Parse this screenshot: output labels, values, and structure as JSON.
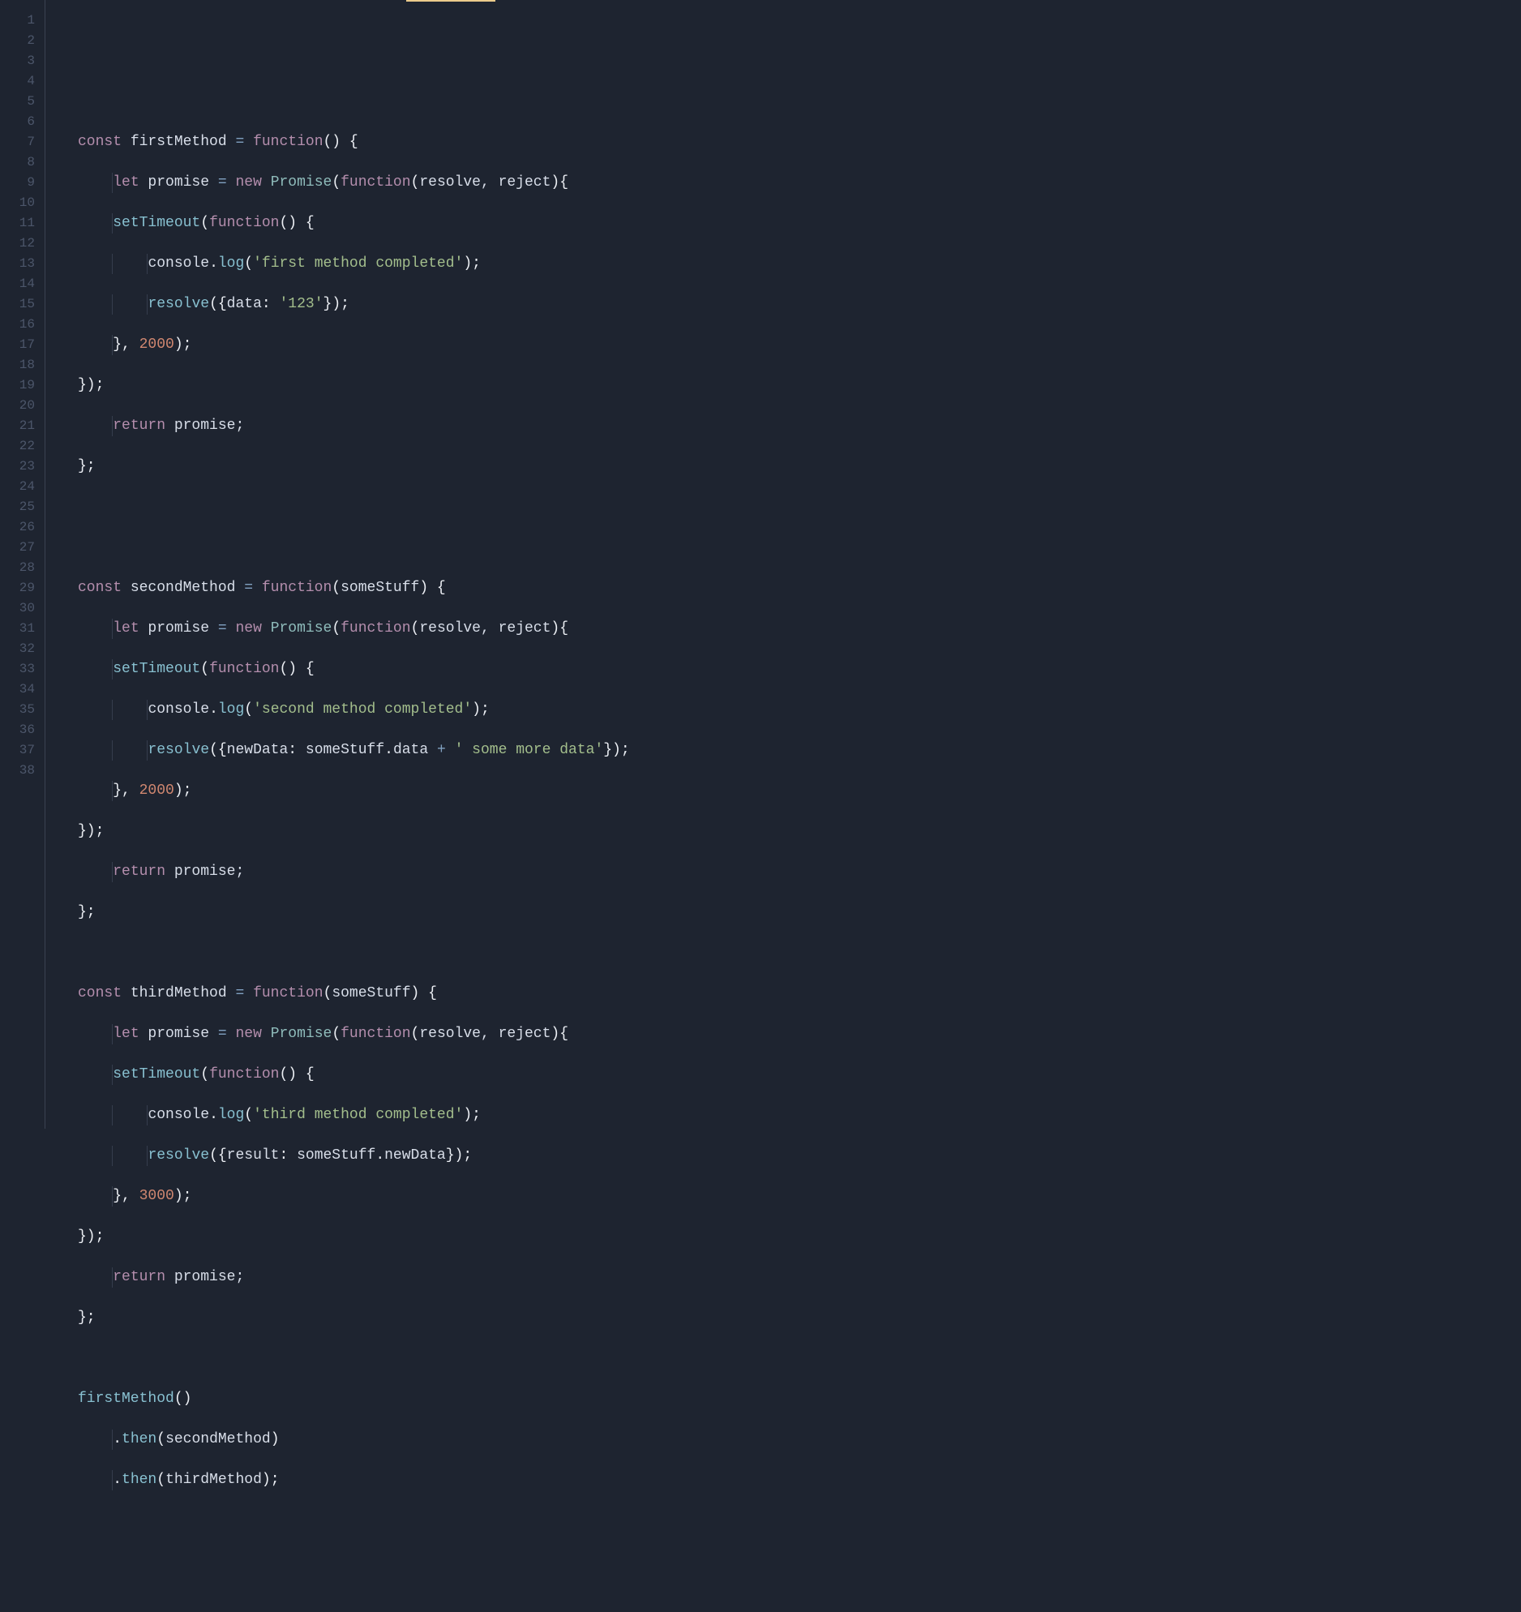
{
  "editor": {
    "lineNumbers": [
      "1",
      "2",
      "3",
      "4",
      "5",
      "6",
      "7",
      "8",
      "9",
      "10",
      "11",
      "12",
      "13",
      "14",
      "15",
      "16",
      "17",
      "18",
      "19",
      "20",
      "21",
      "22",
      "23",
      "24",
      "25",
      "26",
      "27",
      "28",
      "29",
      "30",
      "31",
      "32",
      "33",
      "34",
      "35",
      "36",
      "37",
      "38"
    ]
  },
  "code": {
    "ln1": "",
    "ln2": "",
    "ln3_const": "const",
    "ln3_name": " firstMethod ",
    "ln3_eq": "=",
    "ln3_sp": " ",
    "ln3_func": "function",
    "ln3_paren": "() {",
    "ln4_let": "let",
    "ln4_id1": " promise ",
    "ln4_eq": "=",
    "ln4_sp1": " ",
    "ln4_new": "new",
    "ln4_sp2": " ",
    "ln4_prom": "Promise",
    "ln4_p1": "(",
    "ln4_func": "function",
    "ln4_p2": "(",
    "ln4_args": "resolve, reject",
    "ln4_p3": "){",
    "ln5_st": "setTimeout",
    "ln5_p1": "(",
    "ln5_func": "function",
    "ln5_p2": "() {",
    "ln6_cons": "console",
    "ln6_dot": ".",
    "ln6_log": "log",
    "ln6_p1": "(",
    "ln6_str": "'first method completed'",
    "ln6_p2": ");",
    "ln7_res": "resolve",
    "ln7_p1": "({",
    "ln7_key": "data",
    "ln7_col": ": ",
    "ln7_val": "'123'",
    "ln7_p2": "});",
    "ln8_p1": "}, ",
    "ln8_num": "2000",
    "ln8_p2": ");",
    "ln9": "});",
    "ln10_ret": "return",
    "ln10_id": " promise;",
    "ln11": "};",
    "ln12": "",
    "ln13": "",
    "ln14_const": "const",
    "ln14_name": " secondMethod ",
    "ln14_eq": "=",
    "ln14_sp": " ",
    "ln14_func": "function",
    "ln14_p1": "(",
    "ln14_arg": "someStuff",
    "ln14_p2": ") {",
    "ln15_let": "let",
    "ln15_id1": " promise ",
    "ln15_eq": "=",
    "ln15_sp1": " ",
    "ln15_new": "new",
    "ln15_sp2": " ",
    "ln15_prom": "Promise",
    "ln15_p1": "(",
    "ln15_func": "function",
    "ln15_p2": "(",
    "ln15_args": "resolve, reject",
    "ln15_p3": "){",
    "ln16_st": "setTimeout",
    "ln16_p1": "(",
    "ln16_func": "function",
    "ln16_p2": "() {",
    "ln17_cons": "console",
    "ln17_dot": ".",
    "ln17_log": "log",
    "ln17_p1": "(",
    "ln17_str": "'second method completed'",
    "ln17_p2": ");",
    "ln18_res": "resolve",
    "ln18_p1": "({",
    "ln18_key": "newData",
    "ln18_col": ": ",
    "ln18_obj": "someStuff",
    "ln18_dot": ".",
    "ln18_prop": "data ",
    "ln18_plus": "+",
    "ln18_sp": " ",
    "ln18_str": "' some more data'",
    "ln18_p2": "});",
    "ln19_p1": "}, ",
    "ln19_num": "2000",
    "ln19_p2": ");",
    "ln20": "});",
    "ln21_ret": "return",
    "ln21_id": " promise;",
    "ln22": "};",
    "ln23": "",
    "ln24_const": "const",
    "ln24_name": " thirdMethod ",
    "ln24_eq": "=",
    "ln24_sp": " ",
    "ln24_func": "function",
    "ln24_p1": "(",
    "ln24_arg": "someStuff",
    "ln24_p2": ") {",
    "ln25_let": "let",
    "ln25_id1": " promise ",
    "ln25_eq": "=",
    "ln25_sp1": " ",
    "ln25_new": "new",
    "ln25_sp2": " ",
    "ln25_prom": "Promise",
    "ln25_p1": "(",
    "ln25_func": "function",
    "ln25_p2": "(",
    "ln25_args": "resolve, reject",
    "ln25_p3": "){",
    "ln26_st": "setTimeout",
    "ln26_p1": "(",
    "ln26_func": "function",
    "ln26_p2": "() {",
    "ln27_cons": "console",
    "ln27_dot": ".",
    "ln27_log": "log",
    "ln27_p1": "(",
    "ln27_str": "'third method completed'",
    "ln27_p2": ");",
    "ln28_res": "resolve",
    "ln28_p1": "({",
    "ln28_key": "result",
    "ln28_col": ": ",
    "ln28_obj": "someStuff",
    "ln28_dot": ".",
    "ln28_prop": "newData",
    "ln28_p2": "});",
    "ln29_p1": "}, ",
    "ln29_num": "3000",
    "ln29_p2": ");",
    "ln30": "});",
    "ln31_ret": "return",
    "ln31_id": " promise;",
    "ln32": "};",
    "ln33": "",
    "ln34_fn": "firstMethod",
    "ln34_p": "()",
    "ln35_dot": ".",
    "ln35_then": "then",
    "ln35_p1": "(",
    "ln35_arg": "secondMethod",
    "ln35_p2": ")",
    "ln36_dot": ".",
    "ln36_then": "then",
    "ln36_p1": "(",
    "ln36_arg": "thirdMethod",
    "ln36_p2": ");",
    "ln37": "",
    "ln38": ""
  }
}
